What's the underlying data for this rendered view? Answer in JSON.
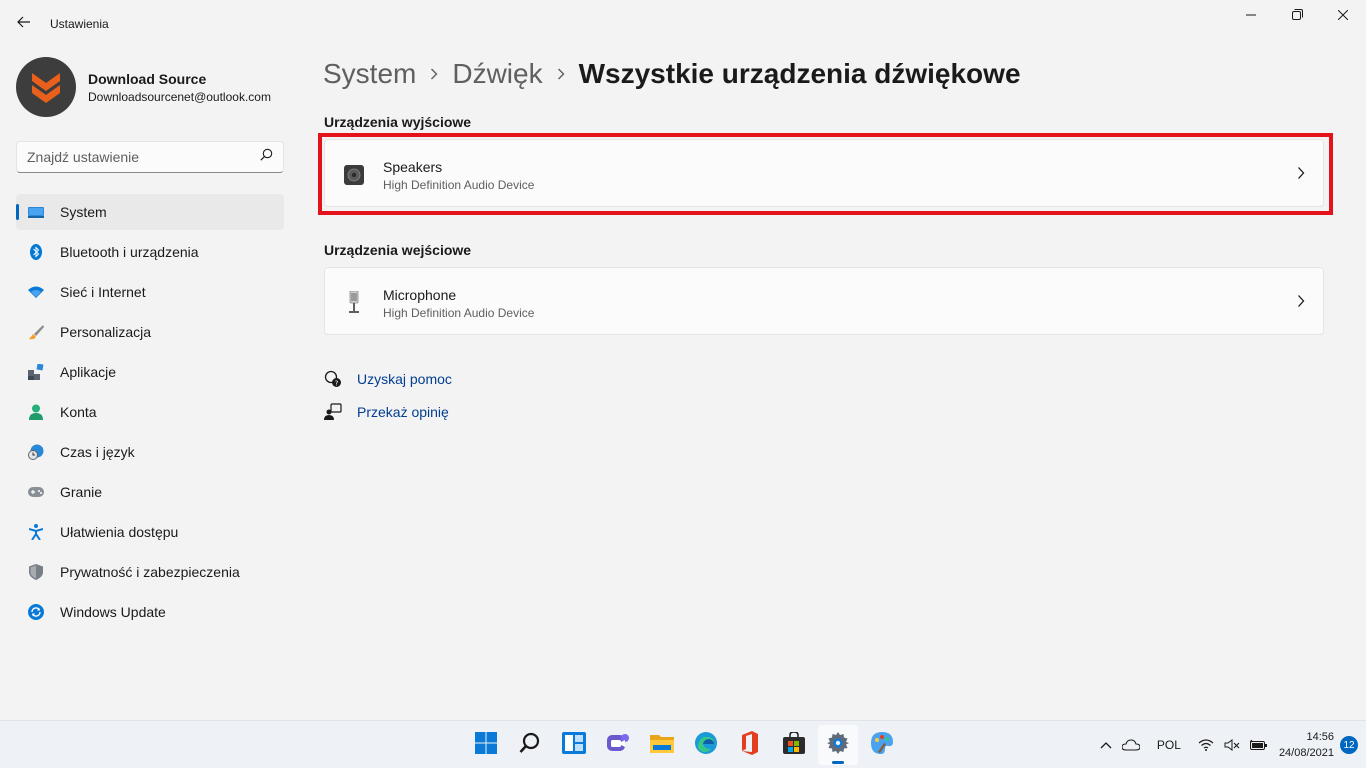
{
  "window": {
    "title": "Ustawienia",
    "back_icon": "back-arrow-icon",
    "minimize_icon": "minimize-icon",
    "restore_icon": "restore-icon",
    "close_icon": "close-icon"
  },
  "profile": {
    "name": "Download Source",
    "email": "Downloadsourcenet@outlook.com",
    "avatar_colors": {
      "bg": "#3d3d3d",
      "accent": "#e8601c"
    }
  },
  "search": {
    "placeholder": "Znajdź ustawienie",
    "value": ""
  },
  "sidebar": {
    "items": [
      {
        "label": "System",
        "icon": "system-icon",
        "active": true
      },
      {
        "label": "Bluetooth i urządzenia",
        "icon": "bluetooth-icon"
      },
      {
        "label": "Sieć i Internet",
        "icon": "wifi-icon"
      },
      {
        "label": "Personalizacja",
        "icon": "brush-icon"
      },
      {
        "label": "Aplikacje",
        "icon": "apps-icon"
      },
      {
        "label": "Konta",
        "icon": "account-icon"
      },
      {
        "label": "Czas i język",
        "icon": "time-language-icon"
      },
      {
        "label": "Granie",
        "icon": "gamepad-icon"
      },
      {
        "label": "Ułatwienia dostępu",
        "icon": "accessibility-icon"
      },
      {
        "label": "Prywatność i zabezpieczenia",
        "icon": "shield-icon"
      },
      {
        "label": "Windows Update",
        "icon": "windows-update-icon"
      }
    ]
  },
  "breadcrumb": {
    "items": [
      "System",
      "Dźwięk"
    ],
    "current": "Wszystkie urządzenia dźwiękowe"
  },
  "output_section": {
    "title": "Urządzenia wyjściowe",
    "devices": [
      {
        "name": "Speakers",
        "description": "High Definition Audio Device",
        "icon": "speaker-icon"
      }
    ]
  },
  "input_section": {
    "title": "Urządzenia wejściowe",
    "devices": [
      {
        "name": "Microphone",
        "description": "High Definition Audio Device",
        "icon": "microphone-icon"
      }
    ]
  },
  "help_links": [
    {
      "label": "Uzyskaj pomoc",
      "icon": "help-icon"
    },
    {
      "label": "Przekaż opinię",
      "icon": "feedback-icon"
    }
  ],
  "taskbar": {
    "apps": [
      {
        "name": "start",
        "icon": "windows-start-icon"
      },
      {
        "name": "search",
        "icon": "search-icon"
      },
      {
        "name": "widgets",
        "icon": "widgets-icon"
      },
      {
        "name": "chat",
        "icon": "teams-chat-icon"
      },
      {
        "name": "explorer",
        "icon": "file-explorer-icon"
      },
      {
        "name": "edge",
        "icon": "edge-icon"
      },
      {
        "name": "office",
        "icon": "office-icon"
      },
      {
        "name": "store",
        "icon": "store-icon"
      },
      {
        "name": "settings",
        "icon": "settings-gear-icon",
        "active": true
      },
      {
        "name": "paint",
        "icon": "paint-icon"
      }
    ],
    "tray": {
      "language": "POL",
      "time": "14:56",
      "date": "24/08/2021",
      "notifications": "12"
    }
  },
  "colors": {
    "accent": "#0067c0",
    "highlight": "#e3121b",
    "link": "#003e92",
    "background": "#f3f3f3"
  }
}
